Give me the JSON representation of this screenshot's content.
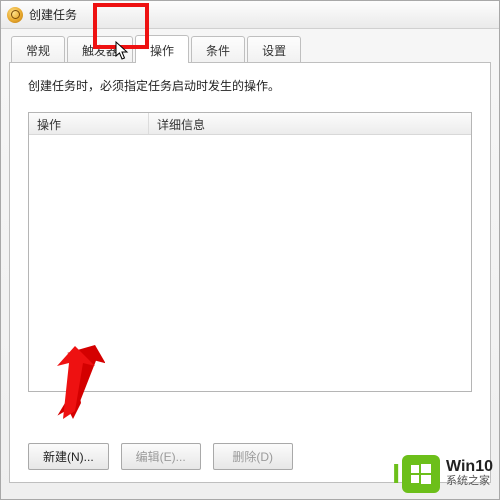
{
  "window": {
    "title": "创建任务"
  },
  "tabs": [
    {
      "label": "常规"
    },
    {
      "label": "触发器"
    },
    {
      "label": "操作"
    },
    {
      "label": "条件"
    },
    {
      "label": "设置"
    }
  ],
  "instruction": "创建任务时，必须指定任务启动时发生的操作。",
  "list": {
    "col_action": "操作",
    "col_detail": "详细信息"
  },
  "buttons": {
    "new": "新建(N)...",
    "edit": "编辑(E)...",
    "delete": "删除(D)"
  },
  "brand": {
    "name": "Win10",
    "sub": "系统之家"
  }
}
